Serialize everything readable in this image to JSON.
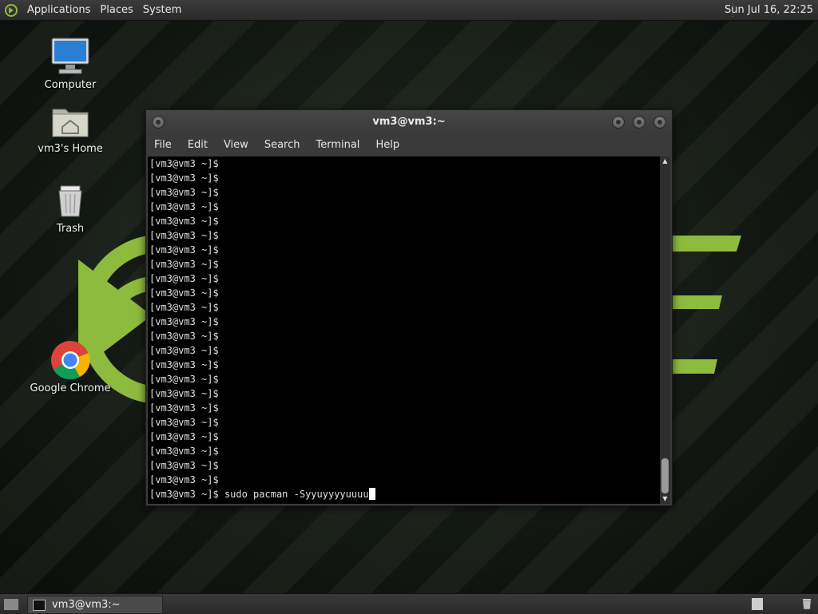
{
  "top_panel": {
    "menus": [
      "Applications",
      "Places",
      "System"
    ],
    "clock": "Sun Jul 16, 22:25"
  },
  "desktop": {
    "icons": [
      {
        "label": "Computer",
        "icon": "computer-icon"
      },
      {
        "label": "vm3's Home",
        "icon": "home-folder-icon"
      },
      {
        "label": "Trash",
        "icon": "trash-icon"
      },
      {
        "label": "Google Chrome",
        "icon": "chrome-icon"
      }
    ],
    "colors": {
      "brand_green": "#87b23a"
    }
  },
  "terminal": {
    "title": "vm3@vm3:~",
    "menu": [
      "File",
      "Edit",
      "View",
      "Search",
      "Terminal",
      "Help"
    ],
    "prompt": "[vm3@vm3 ~]$",
    "empty_prompt_lines": 23,
    "last_command": "sudo pacman -Syyuyyyyuuuu"
  },
  "bottom_panel": {
    "task_label": "vm3@vm3:~"
  }
}
